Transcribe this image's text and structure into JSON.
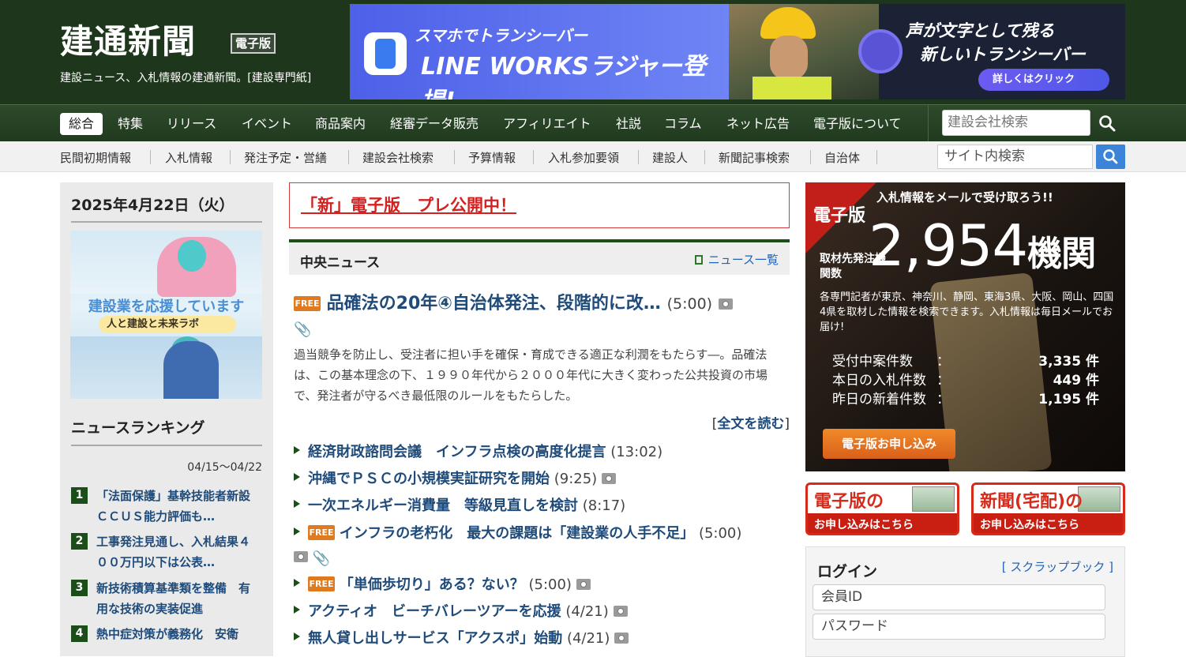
{
  "header": {
    "logo": "建通新聞",
    "logo_badge": "電子版",
    "tagline": "建設ニュース、入札情報の建通新聞。[建設専門紙]",
    "banner": {
      "line1": "スマホでトランシーバー",
      "line2": "LINE WORKSラジャー登場!",
      "right_line1": "声が文字として残る",
      "right_line2": "新しいトランシーバー",
      "button": "詳しくはクリック"
    }
  },
  "main_nav": {
    "items": [
      "総合",
      "特集",
      "リリース",
      "イベント",
      "商品案内",
      "経審データ販売",
      "アフィリエイト",
      "社説",
      "コラム",
      "ネット広告",
      "電子版について"
    ],
    "active": "総合",
    "company_search_placeholder": "建設会社検索"
  },
  "sub_nav": {
    "items": [
      "民間初期情報",
      "入札情報",
      "発注予定・営繕",
      "建設会社検索",
      "予算情報",
      "入札参加要領",
      "建設人",
      "新聞記事検索",
      "自治体"
    ],
    "site_search_placeholder": "サイト内検索"
  },
  "left": {
    "date": "2025年4月22日（火）",
    "promo_title": "建設業を応援しています",
    "promo_sub": "人と建設と未来ラボ",
    "ranking_title": "ニュースランキング",
    "ranking_period": "04/15～04/22",
    "ranking": [
      {
        "num": "1",
        "text": "「法面保護」基幹技能者新設　ＣＣＵＳ能力評価も…"
      },
      {
        "num": "2",
        "text": "工事発注見通し、入札結果４００万円以下は公表…"
      },
      {
        "num": "3",
        "text": "新技術積算基準類を整備　有用な技術の実装促進"
      },
      {
        "num": "4",
        "text": "熱中症対策が義務化　安衛"
      }
    ]
  },
  "center": {
    "pre_release": "「新」電子版　プレ公開中！",
    "section_title": "中央ニュース",
    "news_list_link": "ニュース一覧",
    "free_label": "FREE",
    "lead": {
      "title": "品確法の20年④自治体発注、段階的に改…",
      "time": "(5:00)",
      "body": "過当競争を防止し、受注者に担い手を確保・育成できる適正な利潤をもたらす―。品確法は、この基本理念の下、１９９０年代から２０００年代に大きく変わった公共投資の市場で、発注者が守るべき最低限のルールをもたらした。",
      "read_more": "全文を読む"
    },
    "headlines": [
      {
        "title": "経済財政諮問会議　インフラ点検の高度化提言",
        "time": "(13:02)"
      },
      {
        "title": "沖縄でＰＳＣの小規模実証研究を開始",
        "time": "(9:25)"
      },
      {
        "title": "一次エネルギー消費量　等級見直しを検討",
        "time": "(8:17)"
      },
      {
        "title": "インフラの老朽化　最大の課題は「建設業の人手不足」",
        "time": "(5:00)"
      },
      {
        "title": "「単価歩切り」ある？ない？",
        "time": "(5:00)"
      },
      {
        "title": "アクティオ　ビーチバレーツアーを応援",
        "time": "(4/21)"
      },
      {
        "title": "無人貸し出しサービス「アクスポ」始動",
        "time": "(4/21)"
      }
    ]
  },
  "right": {
    "ad": {
      "topbar": "入札情報をメールで受け取ろう!!",
      "edition": "電子版",
      "label": "取材先発注機関数",
      "count": "2,954",
      "count_unit": "機関",
      "desc": "各専門記者が東京、神奈川、静岡、東海3県、大阪、岡山、四国4県を取材した情報を検索できます。入札情報は毎日メールでお届け!",
      "stats": [
        {
          "label": "受付中案件数",
          "value": "3,335 件"
        },
        {
          "label": "本日の入札件数",
          "value": "449 件"
        },
        {
          "label": "昨日の新着件数",
          "value": "1,195 件"
        }
      ],
      "colon": "：",
      "apply": "電子版お申し込み"
    },
    "sub_ads": [
      {
        "title": "電子版の",
        "sub": "お申し込みはこちら"
      },
      {
        "title": "新聞(宅配)の",
        "sub": "お申し込みはこちら"
      }
    ],
    "login": {
      "title": "ログイン",
      "scrapbook": "[ スクラップブック ]",
      "id_placeholder": "会員ID",
      "pw_placeholder": "パスワード"
    }
  }
}
